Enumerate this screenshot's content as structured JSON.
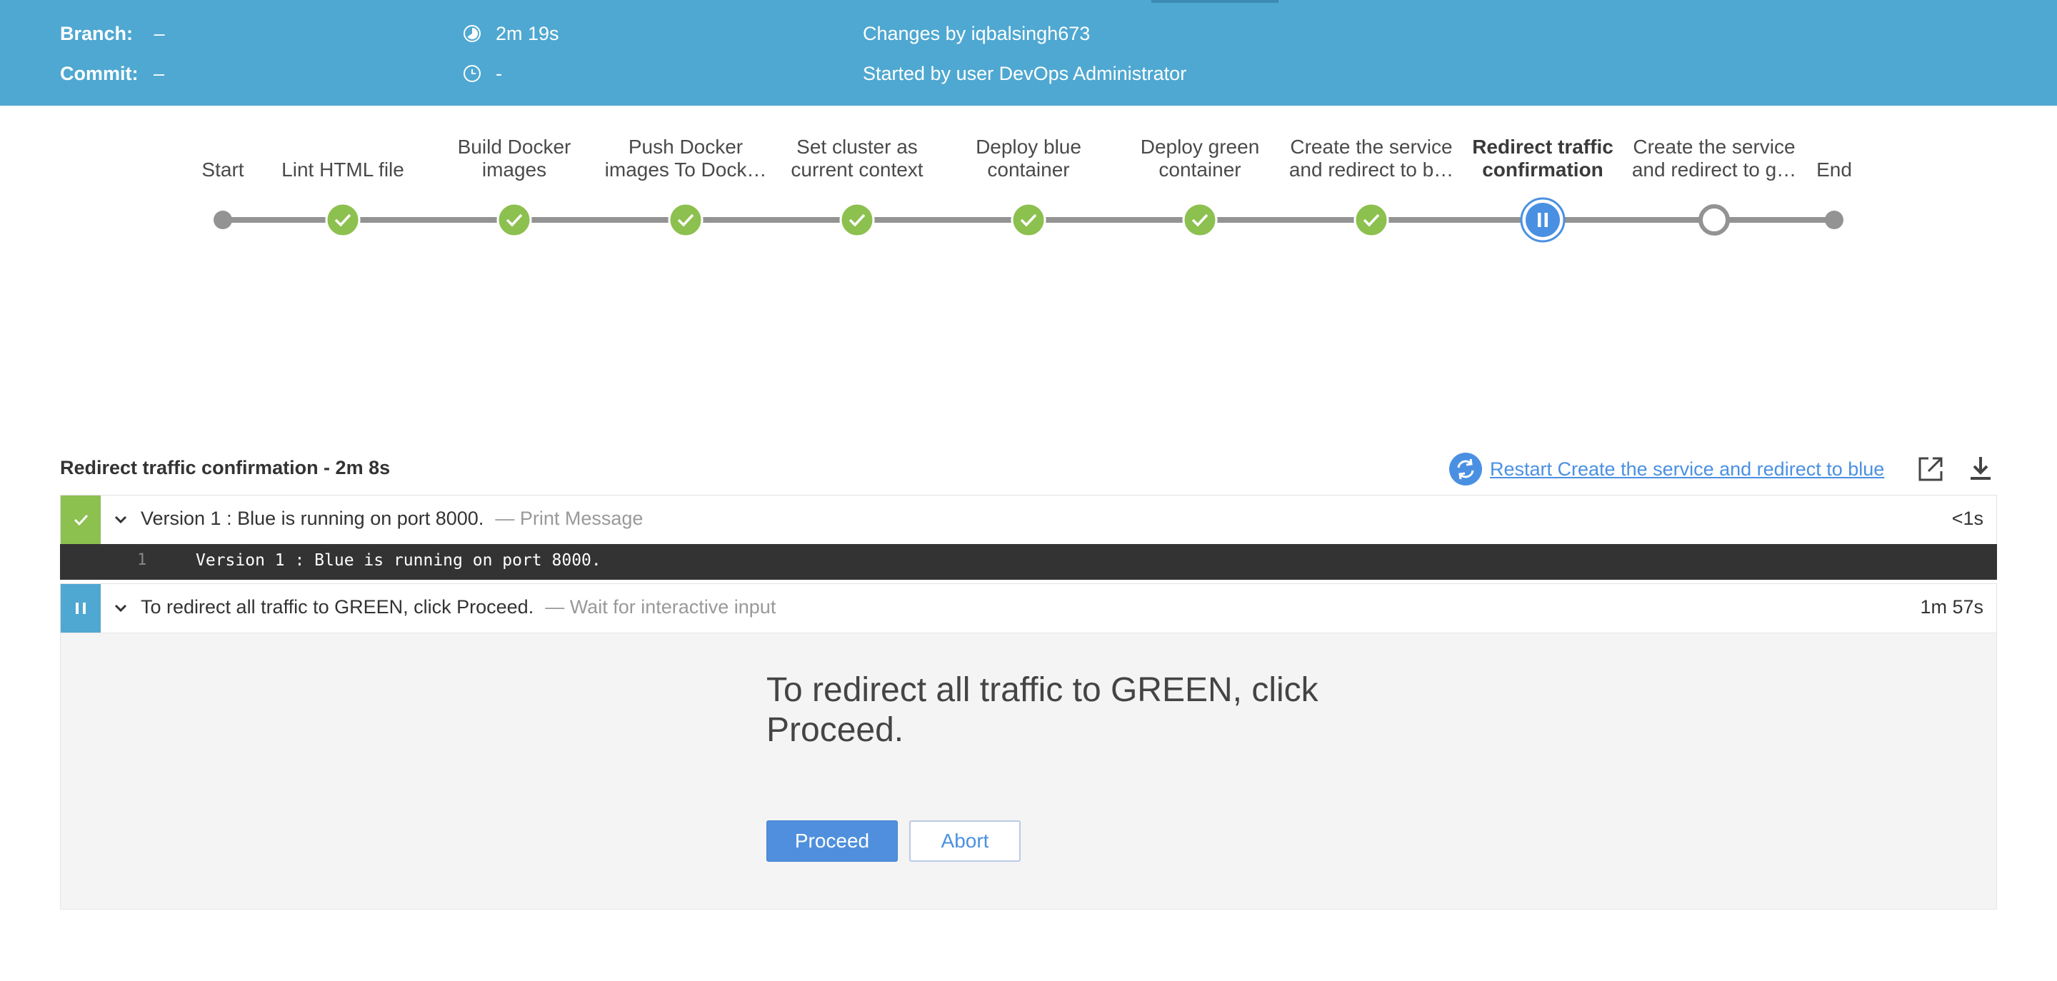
{
  "header": {
    "branch_label": "Branch:",
    "branch_value": "–",
    "commit_label": "Commit:",
    "commit_value": "–",
    "duration": "2m 19s",
    "time_ago": "-",
    "changes": "Changes by iqbalsingh673",
    "started_by": "Started by user DevOps Administrator",
    "duration_icon": "pie-clock-icon",
    "time_icon": "clock-icon"
  },
  "pipeline": {
    "stages": [
      {
        "label": "Start",
        "status": "start"
      },
      {
        "label": "Lint HTML file",
        "status": "success"
      },
      {
        "label": "Build Docker\nimages",
        "status": "success"
      },
      {
        "label": "Push Docker\nimages To Dock…",
        "status": "success"
      },
      {
        "label": "Set cluster as\ncurrent context",
        "status": "success"
      },
      {
        "label": "Deploy blue\ncontainer",
        "status": "success"
      },
      {
        "label": "Deploy green\ncontainer",
        "status": "success"
      },
      {
        "label": "Create the service\nand redirect to b…",
        "status": "success"
      },
      {
        "label": "Redirect traffic\nconfirmation",
        "status": "paused"
      },
      {
        "label": "Create the service\nand redirect to g…",
        "status": "not-built"
      },
      {
        "label": "End",
        "status": "end"
      }
    ]
  },
  "step_panel": {
    "title": "Redirect traffic confirmation - 2m 8s",
    "restart_label": "Restart Create the service and redirect to blue",
    "restart_icon": "restart-icon",
    "open_icon": "open-in-new-icon",
    "download_icon": "download-icon"
  },
  "steps": [
    {
      "title": "Version 1 : Blue is running on port 8000.",
      "type": "— Print Message",
      "duration": "<1s",
      "status": "success",
      "log": [
        {
          "line": "1",
          "text": "Version 1 : Blue is running on port 8000."
        }
      ]
    },
    {
      "title": "To redirect all traffic to GREEN, click Proceed.",
      "type": "— Wait for interactive input",
      "duration": "1m 57s",
      "status": "paused"
    }
  ],
  "input": {
    "message": "To redirect all traffic to GREEN, click Proceed.",
    "proceed_label": "Proceed",
    "abort_label": "Abort"
  },
  "colors": {
    "header_bg": "#4fa8d1",
    "success": "#8cc04f",
    "paused": "#4a90e2",
    "line": "#949393",
    "primary_button": "#4f8fdd"
  }
}
